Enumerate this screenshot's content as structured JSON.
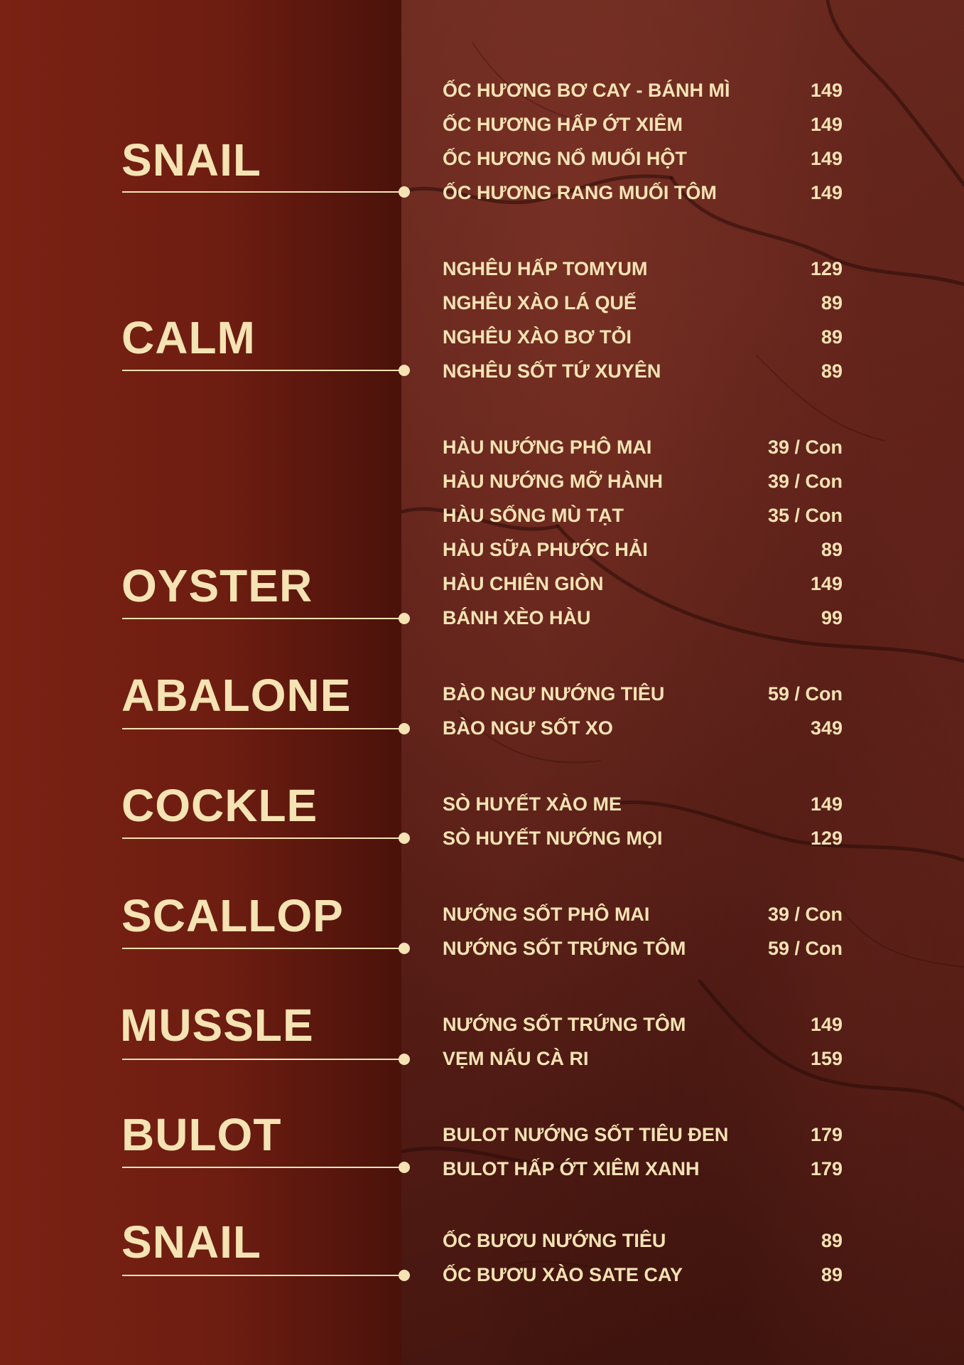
{
  "categories": [
    {
      "title": "SNAIL",
      "items": [
        {
          "name": "ỐC HƯƠNG BƠ CAY - BÁNH MÌ",
          "price": "149"
        },
        {
          "name": "ỐC HƯƠNG HẤP ỚT XIÊM",
          "price": "149"
        },
        {
          "name": "ỐC HƯƠNG NỔ MUỐI HỘT",
          "price": "149"
        },
        {
          "name": "ỐC HƯƠNG RANG MUỐI TÔM",
          "price": "149"
        }
      ]
    },
    {
      "title": "CALM",
      "items": [
        {
          "name": "NGHÊU HẤP TOMYUM",
          "price": "129"
        },
        {
          "name": "NGHÊU XÀO LÁ QUẾ",
          "price": "89"
        },
        {
          "name": "NGHÊU XÀO BƠ TỎI",
          "price": "89"
        },
        {
          "name": "NGHÊU SỐT TỨ XUYÊN",
          "price": "89"
        }
      ]
    },
    {
      "title": "OYSTER",
      "items": [
        {
          "name": "HÀU NƯỚNG PHÔ MAI",
          "price": "39 / Con"
        },
        {
          "name": "HÀU NƯỚNG MỠ HÀNH",
          "price": "39 / Con"
        },
        {
          "name": "HÀU SỐNG MÙ TẠT",
          "price": "35 / Con"
        },
        {
          "name": "HÀU SỮA PHƯỚC HẢI",
          "price": "89"
        },
        {
          "name": "HÀU CHIÊN GIÒN",
          "price": "149"
        },
        {
          "name": "BÁNH XÈO HÀU",
          "price": "99"
        }
      ]
    },
    {
      "title": "ABALONE",
      "items": [
        {
          "name": "BÀO NGƯ NƯỚNG TIÊU",
          "price": "59 / Con"
        },
        {
          "name": "BÀO NGƯ SỐT XO",
          "price": "349"
        }
      ]
    },
    {
      "title": "COCKLE",
      "items": [
        {
          "name": "SÒ HUYẾT XÀO ME",
          "price": "149"
        },
        {
          "name": "SÒ HUYẾT NƯỚNG MỌI",
          "price": "129"
        }
      ]
    },
    {
      "title": "SCALLOP",
      "items": [
        {
          "name": "NƯỚNG SỐT PHÔ MAI",
          "price": "39 / Con"
        },
        {
          "name": "NƯỚNG SỐT TRỨNG TÔM",
          "price": "59 / Con"
        }
      ]
    },
    {
      "title": "MUSSLE",
      "items": [
        {
          "name": "NƯỚNG SỐT TRỨNG TÔM",
          "price": "149"
        },
        {
          "name": "VẸM NẤU CÀ RI",
          "price": "159"
        }
      ]
    },
    {
      "title": "BULOT",
      "items": [
        {
          "name": "BULOT NƯỚNG SỐT TIÊU ĐEN",
          "price": "179"
        },
        {
          "name": "BULOT HẤP ỚT XIÊM XANH",
          "price": "179"
        }
      ]
    },
    {
      "title": "SNAIL",
      "items": [
        {
          "name": "ỐC BƯƠU NƯỚNG TIÊU",
          "price": "89"
        },
        {
          "name": "ỐC BƯƠU XÀO SATE CAY",
          "price": "89"
        }
      ]
    }
  ]
}
